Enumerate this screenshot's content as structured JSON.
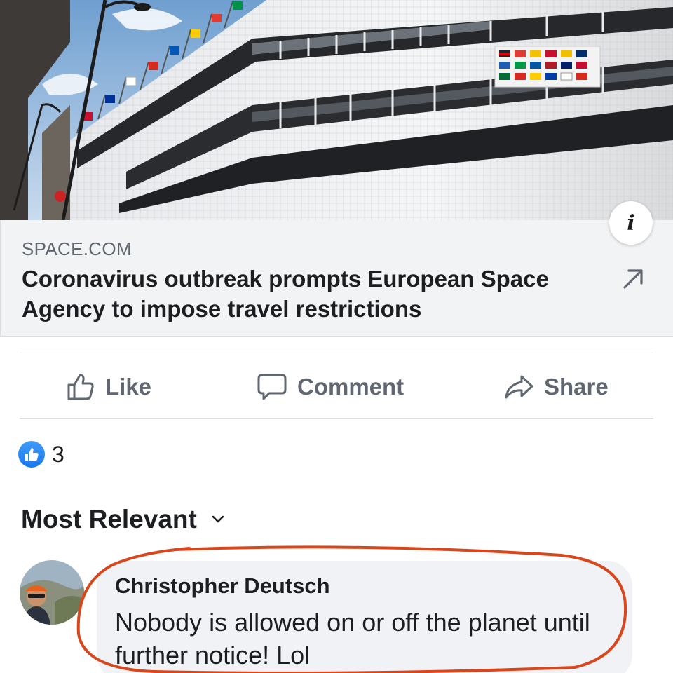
{
  "link_preview": {
    "source": "SPACE.COM",
    "title": "Coronavirus outbreak prompts European Space Agency to impose travel restrictions",
    "info_icon": "info-icon",
    "open_icon": "external-arrow-icon"
  },
  "actions": {
    "like_label": "Like",
    "comment_label": "Comment",
    "share_label": "Share"
  },
  "reactions": {
    "icon": "like-reaction-icon",
    "count": "3"
  },
  "comments_sort": {
    "label": "Most Relevant",
    "icon": "chevron-down-icon"
  },
  "comment": {
    "author": "Christopher Deutsch",
    "text": "Nobody is allowed on or off the planet until further notice! Lol"
  },
  "colors": {
    "accent": "#1877f2",
    "annotation": "#d9461c",
    "muted_text": "#606770",
    "card_bg": "#f2f3f5"
  }
}
